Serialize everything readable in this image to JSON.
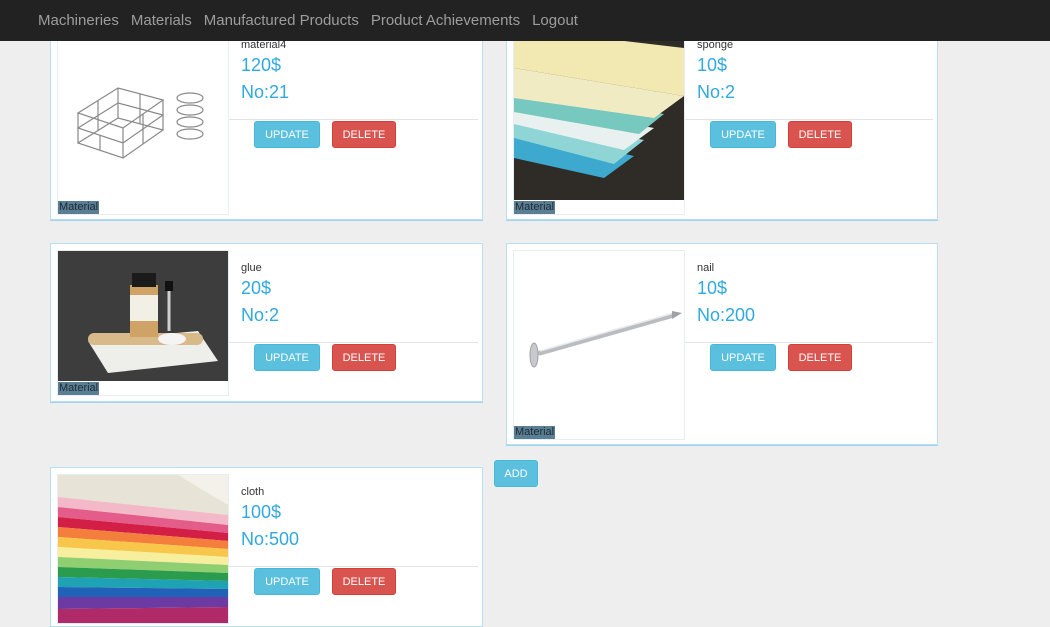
{
  "nav": {
    "items": [
      "Machineries",
      "Materials",
      "Manufactured Products",
      "Product Achievements",
      "Logout"
    ]
  },
  "buttons": {
    "update": "UPDATE",
    "delete": "DELETE",
    "add": "ADD"
  },
  "badge_label": "Material",
  "materials": [
    {
      "name": "material4",
      "price": "120$",
      "qty": "No:21",
      "image": "spring-coils-icon"
    },
    {
      "name": "sponge",
      "price": "10$",
      "qty": "No:2",
      "image": "foam-sheets-icon"
    },
    {
      "name": "glue",
      "price": "20$",
      "qty": "No:2",
      "image": "glue-bottle-icon"
    },
    {
      "name": "nail",
      "price": "10$",
      "qty": "No:200",
      "image": "nail-icon"
    },
    {
      "name": "cloth",
      "price": "100$",
      "qty": "No:500",
      "image": "fabric-stack-icon"
    }
  ],
  "colors": {
    "navbar": "#222222",
    "accent": "#31a9de",
    "update": "#5bc0de",
    "delete": "#d9534f",
    "background": "#eeeeee"
  }
}
